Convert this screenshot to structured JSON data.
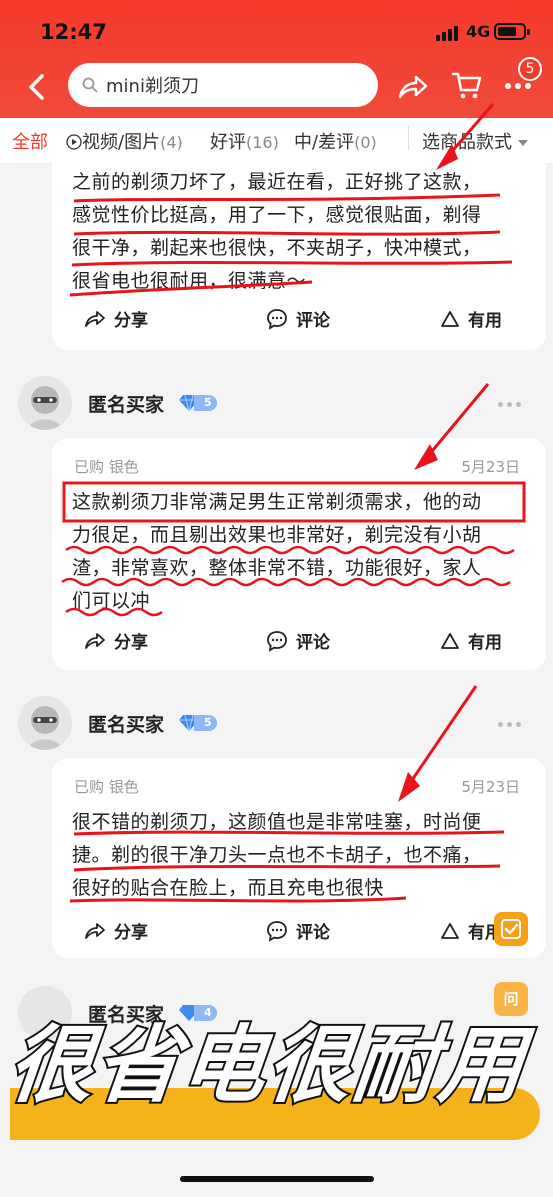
{
  "status_bar": {
    "time": "12:47",
    "network": "4G"
  },
  "search": {
    "query": "mini剃须刀"
  },
  "header": {
    "cart_badge": "5"
  },
  "tabs": [
    {
      "label": "全部",
      "count": ""
    },
    {
      "label": "视频/图片",
      "count": "(4)"
    },
    {
      "label": "好评",
      "count": "(16)"
    },
    {
      "label": "中/差评",
      "count": "(0)"
    }
  ],
  "style_filter": {
    "label": "选商品款式"
  },
  "reviews": [
    {
      "text_lines": [
        "之前的剃须刀坏了，最近在看，正好挑了这款，",
        "感觉性价比挺高，用了一下，感觉很贴面，剃得",
        "很干净，剃起来也很快，不夹胡子，快冲模式，",
        "很省电也很耐用，很满意～"
      ],
      "actions": {
        "share": "分享",
        "comment": "评论",
        "useful": "有用"
      }
    },
    {
      "user": "匿名买家",
      "level": "5",
      "purchase": "已购 银色",
      "date": "5月23日",
      "text_lines": [
        "这款剃须刀非常满足男生正常剃须需求，他的动",
        "力很足，而且剔出效果也非常好，剃完没有小胡",
        "渣，非常喜欢，整体非常不错，功能很好，家人",
        "们可以冲"
      ],
      "actions": {
        "share": "分享",
        "comment": "评论",
        "useful": "有用"
      }
    },
    {
      "user": "匿名买家",
      "level": "5",
      "purchase": "已购 银色",
      "date": "5月23日",
      "text_lines": [
        "很不错的剃须刀，这颜值也是非常哇塞，时尚便",
        "捷。剃的很干净刀头一点也不卡胡子，也不痛，",
        "很好的贴合在脸上，而且充电也很快"
      ],
      "actions": {
        "share": "分享",
        "comment": "评论",
        "useful": "有用"
      }
    }
  ],
  "next_user": {
    "user": "匿名买家",
    "level": "4"
  },
  "float": {
    "ask": "问"
  },
  "caption": "很省电很耐用",
  "colors": {
    "brand_red": "#f53a2a",
    "annotation_red": "#e8141c",
    "caption_yellow": "#f6b21b"
  }
}
